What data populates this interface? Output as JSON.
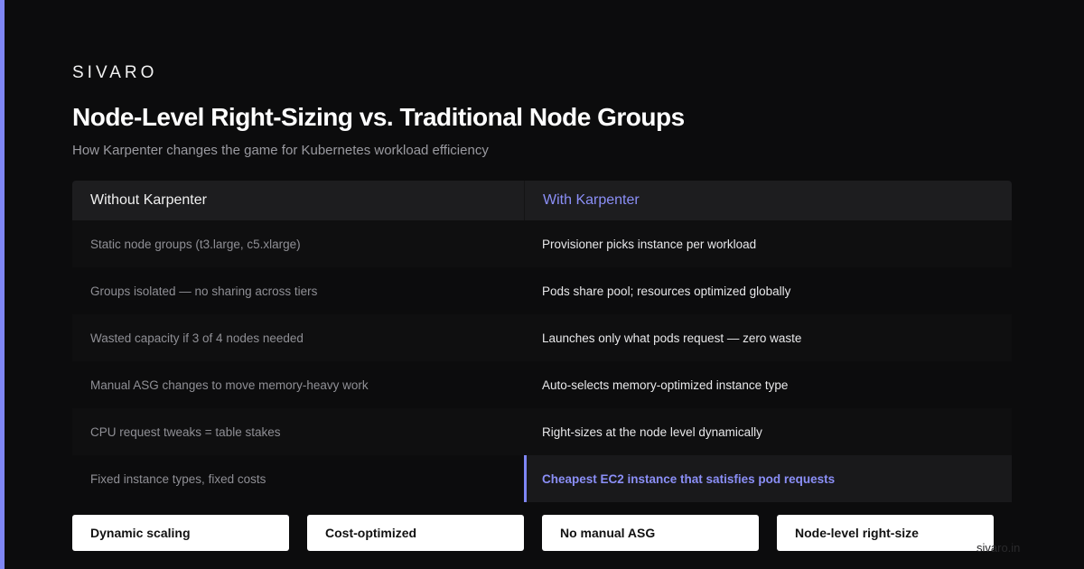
{
  "brand": "SIVARO",
  "title": "Node-Level Right-Sizing vs. Traditional Node Groups",
  "subtitle": "How Karpenter changes the game for Kubernetes workload efficiency",
  "table": {
    "headers": {
      "left": "Without Karpenter",
      "right": "With Karpenter"
    },
    "rows": [
      {
        "left": "Static node groups (t3.large, c5.xlarge)",
        "right": "Provisioner picks instance per workload"
      },
      {
        "left": "Groups isolated — no sharing across tiers",
        "right": "Pods share pool; resources optimized globally"
      },
      {
        "left": "Wasted capacity if 3 of 4 nodes needed",
        "right": "Launches only what pods request — zero waste"
      },
      {
        "left": "Manual ASG changes to move memory-heavy work",
        "right": "Auto-selects memory-optimized instance type"
      },
      {
        "left": "CPU request tweaks = table stakes",
        "right": "Right-sizes at the node level dynamically"
      },
      {
        "left": "Fixed instance types, fixed costs",
        "right": "Cheapest EC2 instance that satisfies pod requests"
      }
    ]
  },
  "chips": [
    "Dynamic scaling",
    "Cost-optimized",
    "No manual ASG",
    "Node-level right-size"
  ],
  "watermark": "sivaro.in",
  "colors": {
    "accent": "#7f86f5",
    "background": "#0c0c0d",
    "header": "#1d1d1f"
  }
}
